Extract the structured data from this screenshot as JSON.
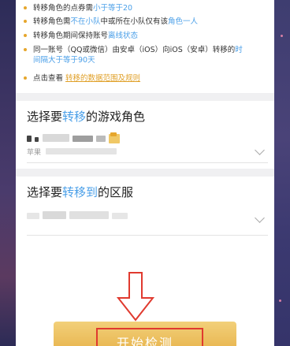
{
  "rules": [
    {
      "parts": [
        {
          "t": "转移角色的点券需"
        },
        {
          "t": "小于等于20",
          "c": "hl"
        }
      ]
    },
    {
      "parts": [
        {
          "t": "转移角色需"
        },
        {
          "t": "不在小队",
          "c": "hl"
        },
        {
          "t": "中或所在小队仅有该"
        },
        {
          "t": "角色一人",
          "c": "hl"
        }
      ]
    },
    {
      "parts": [
        {
          "t": "转移角色期间保持账号"
        },
        {
          "t": "离线状态",
          "c": "hl"
        }
      ]
    },
    {
      "parts": [
        {
          "t": "同一账号（QQ或微信）由安卓（iOS）向iOS（安卓）转移的"
        },
        {
          "t": "时",
          "c": "hl"
        }
      ]
    },
    {
      "parts": [
        {
          "t": "间隔大于等于90天",
          "c": "hl"
        }
      ],
      "indent": true
    },
    {
      "parts": [
        {
          "t": "点击查看 "
        },
        {
          "t": "转移的数据范围及规则",
          "c": "hl-gold"
        }
      ]
    }
  ],
  "role_section": {
    "title_pre": "选择要",
    "title_hl": "转移",
    "title_post": "的游戏角色",
    "platform_text": "苹果"
  },
  "server_section": {
    "title_pre": "选择要",
    "title_hl": "转移到",
    "title_post": "的区服"
  },
  "start_button": {
    "label": "开始检测"
  },
  "colors": {
    "accent_blue": "#4a9fe8",
    "accent_gold": "#e6a62c",
    "annotation_red": "#e03a2f"
  }
}
